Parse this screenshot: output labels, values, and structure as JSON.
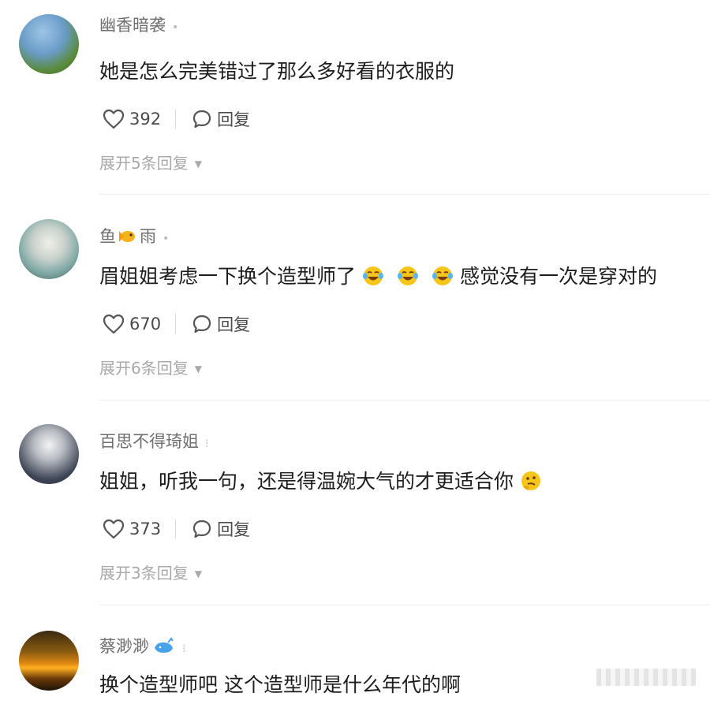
{
  "comments": [
    {
      "username": "幽香暗袭",
      "badge": "•",
      "text_parts": [
        "她是怎么完美错过了那么多好看的衣服的"
      ],
      "likes": "392",
      "reply_label": "回复",
      "expand": "展开5条回复"
    },
    {
      "username": "鱼",
      "username_suffix": "雨",
      "badge": "•",
      "text_parts": [
        "眉姐姐考虑一下换个造型师了",
        "感觉没有一次是穿对的"
      ],
      "likes": "670",
      "reply_label": "回复",
      "expand": "展开6条回复"
    },
    {
      "username": "百思不得琦姐",
      "badge": "⁝",
      "text_parts": [
        "姐姐，听我一句，还是得温婉大气的才更适合你"
      ],
      "likes": "373",
      "reply_label": "回复",
      "expand": "展开3条回复"
    },
    {
      "username": "蔡渺渺",
      "badge": "⁝",
      "text_parts": [
        "换个造型师吧 这个造型师是什么年代的啊"
      ]
    }
  ],
  "colors": {
    "username": "#6f6f6f",
    "text": "#1d1d1d",
    "meta": "#a9a9a9",
    "emoji_yellow": "#f5c518"
  },
  "icons": [
    "heart-icon",
    "comment-bubble-icon",
    "laughing-crying-emoji",
    "thinking-emoji",
    "fish-emoji",
    "whale-emoji"
  ]
}
